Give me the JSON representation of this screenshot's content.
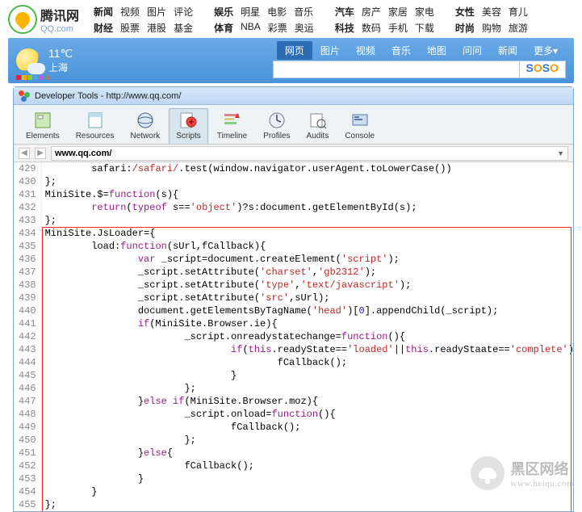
{
  "qq": {
    "cn": "腾讯网",
    "en": "QQ.com",
    "nav": [
      {
        "head": "新闻",
        "r1": [
          "视频",
          "图片",
          "评论"
        ],
        "head2": "财经",
        "r2": [
          "股票",
          "港股",
          "基金"
        ]
      },
      {
        "head": "娱乐",
        "r1": [
          "明星",
          "电影",
          "音乐"
        ],
        "head2": "体育",
        "r2": [
          "NBA",
          "彩票",
          "奥运"
        ]
      },
      {
        "head": "汽车",
        "r1": [
          "房产",
          "家居",
          "家电"
        ],
        "head2": "科技",
        "r2": [
          "数码",
          "手机",
          "下载"
        ]
      },
      {
        "head": "女性",
        "r1": [
          "美容",
          "育儿"
        ],
        "head2": "时尚",
        "r2": [
          "购物",
          "旅游"
        ]
      }
    ]
  },
  "weather": {
    "temp": "11℃",
    "city": "上海",
    "colors": [
      "#e23",
      "#fa0",
      "#8c3",
      "#4ad",
      "#a6d",
      "#888"
    ],
    "tabs": [
      "网页",
      "图片",
      "视频",
      "音乐",
      "地图",
      "问问",
      "新闻",
      "更多▾"
    ],
    "activeTab": 0,
    "search_placeholder": "",
    "soso": [
      "S",
      "O",
      "S",
      "O"
    ]
  },
  "devtools": {
    "title": "Developer Tools - http://www.qq.com/",
    "buttons": [
      "Elements",
      "Resources",
      "Network",
      "Scripts",
      "Timeline",
      "Profiles",
      "Audits",
      "Console"
    ],
    "activeBtn": 3,
    "url": "www.qq.com/",
    "iconColors": [
      "#e43",
      "#4b4",
      "#47c"
    ]
  },
  "code": {
    "startLine": 429,
    "endLine": 455,
    "boxTop": 4,
    "lines": [
      [
        {
          "t": "        safari:"
        },
        {
          "t": "/safari/",
          "c": "str"
        },
        {
          "t": ".test(window.navigator.userAgent.toLowerCase())"
        }
      ],
      [
        {
          "t": "};"
        }
      ],
      [
        {
          "t": "MiniSite.$="
        },
        {
          "t": "function",
          "c": "kw"
        },
        {
          "t": "(s){"
        }
      ],
      [
        {
          "t": "        "
        },
        {
          "t": "return",
          "c": "kw"
        },
        {
          "t": "("
        },
        {
          "t": "typeof",
          "c": "kw"
        },
        {
          "t": " s=="
        },
        {
          "t": "'object'",
          "c": "str"
        },
        {
          "t": ")?s:document.getElementById(s);"
        }
      ],
      [
        {
          "t": "};"
        }
      ],
      [
        {
          "t": "MiniSite.JsLoader={"
        }
      ],
      [
        {
          "t": "        load:"
        },
        {
          "t": "function",
          "c": "kw"
        },
        {
          "t": "(sUrl,fCallback){"
        }
      ],
      [
        {
          "t": "                "
        },
        {
          "t": "var",
          "c": "kw"
        },
        {
          "t": " _script=document.createElement("
        },
        {
          "t": "'script'",
          "c": "str"
        },
        {
          "t": ");"
        }
      ],
      [
        {
          "t": "                _script.setAttribute("
        },
        {
          "t": "'charset'",
          "c": "str"
        },
        {
          "t": ","
        },
        {
          "t": "'gb2312'",
          "c": "str"
        },
        {
          "t": ");"
        }
      ],
      [
        {
          "t": "                _script.setAttribute("
        },
        {
          "t": "'type'",
          "c": "str"
        },
        {
          "t": ","
        },
        {
          "t": "'text/javascript'",
          "c": "str"
        },
        {
          "t": ");"
        }
      ],
      [
        {
          "t": "                _script.setAttribute("
        },
        {
          "t": "'src'",
          "c": "str"
        },
        {
          "t": ",sUrl);"
        }
      ],
      [
        {
          "t": "                document.getElementsByTagName("
        },
        {
          "t": "'head'",
          "c": "str"
        },
        {
          "t": ")["
        },
        {
          "t": "0",
          "c": "num"
        },
        {
          "t": "].appendChild(_script);"
        }
      ],
      [
        {
          "t": "                "
        },
        {
          "t": "if",
          "c": "kw"
        },
        {
          "t": "(MiniSite.Browser.ie){"
        }
      ],
      [
        {
          "t": "                        _script.onreadystatechange="
        },
        {
          "t": "function",
          "c": "kw"
        },
        {
          "t": "(){"
        }
      ],
      [
        {
          "t": "                                "
        },
        {
          "t": "if",
          "c": "kw"
        },
        {
          "t": "("
        },
        {
          "t": "this",
          "c": "kw"
        },
        {
          "t": ".readyState=="
        },
        {
          "t": "'loaded'",
          "c": "str"
        },
        {
          "t": "||"
        },
        {
          "t": "this",
          "c": "kw"
        },
        {
          "t": ".readyStaate=="
        },
        {
          "t": "'complete'",
          "c": "str"
        },
        {
          "t": "){"
        }
      ],
      [
        {
          "t": "                                        fCallback();"
        }
      ],
      [
        {
          "t": "                                }"
        }
      ],
      [
        {
          "t": "                        };"
        }
      ],
      [
        {
          "t": "                }"
        },
        {
          "t": "else if",
          "c": "kw"
        },
        {
          "t": "(MiniSite.Browser.moz){"
        }
      ],
      [
        {
          "t": "                        _script.onload="
        },
        {
          "t": "function",
          "c": "kw"
        },
        {
          "t": "(){"
        }
      ],
      [
        {
          "t": "                                fCallback();"
        }
      ],
      [
        {
          "t": "                        };"
        }
      ],
      [
        {
          "t": "                }"
        },
        {
          "t": "else",
          "c": "kw"
        },
        {
          "t": "{"
        }
      ],
      [
        {
          "t": "                        fCallback();"
        }
      ],
      [
        {
          "t": "                }"
        }
      ],
      [
        {
          "t": "        }"
        }
      ],
      [
        {
          "t": "};"
        }
      ]
    ]
  },
  "watermark": {
    "cn": "黑区网络",
    "en": "www.heiqu.com"
  }
}
